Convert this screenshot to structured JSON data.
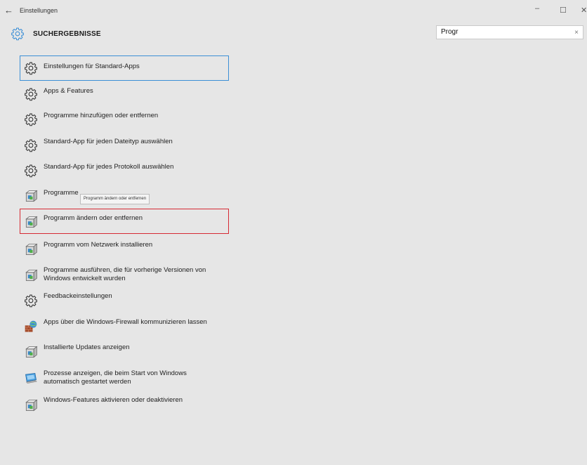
{
  "window": {
    "title": "Einstellungen",
    "back_glyph": "←",
    "minimize_glyph": "–",
    "maximize_glyph": "☐",
    "close_glyph": "✕"
  },
  "header": {
    "title": "SUCHERGEBNISSE"
  },
  "search": {
    "value": "Progr",
    "clear_glyph": "×"
  },
  "accent_color": "#3c8fd6",
  "highlight_color": "#d62a33",
  "tooltip": {
    "text": "Programm ändern oder entfernen"
  },
  "results": [
    {
      "label": "Einstellungen für Standard-Apps",
      "icon": "gear-icon"
    },
    {
      "label": "Apps & Features",
      "icon": "gear-icon"
    },
    {
      "label": "Programme hinzufügen oder entfernen",
      "icon": "gear-icon"
    },
    {
      "label": "Standard-App für jeden Dateityp auswählen",
      "icon": "gear-icon"
    },
    {
      "label": "Standard-App für jedes Protokoll auswählen",
      "icon": "gear-icon"
    },
    {
      "label": "Programme",
      "icon": "programs-icon"
    },
    {
      "label": "Programm ändern oder entfernen",
      "icon": "programs-icon"
    },
    {
      "label": "Programm vom Netzwerk installieren",
      "icon": "programs-icon"
    },
    {
      "label": "Programme ausführen, die für vorherige Versionen von",
      "label2": "Windows entwickelt wurden",
      "icon": "programs-icon"
    },
    {
      "label": "Feedbackeinstellungen",
      "icon": "gear-icon"
    },
    {
      "label": "Apps über die Windows-Firewall kommunizieren lassen",
      "icon": "firewall-icon"
    },
    {
      "label": "Installierte Updates anzeigen",
      "icon": "programs-icon"
    },
    {
      "label": "Prozesse anzeigen, die beim Start von Windows",
      "label2": "automatisch gestartet werden",
      "icon": "monitor-icon"
    },
    {
      "label": "Windows-Features aktivieren oder deaktivieren",
      "icon": "programs-icon"
    }
  ]
}
